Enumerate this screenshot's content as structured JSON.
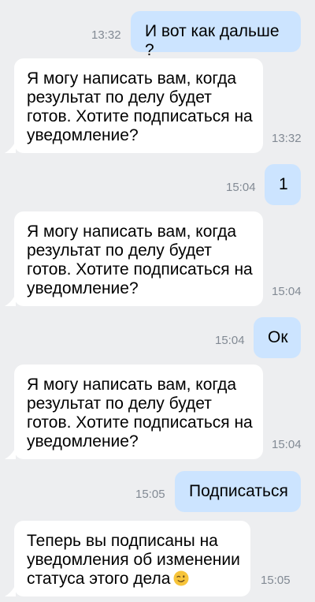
{
  "messages": [
    {
      "direction": "out",
      "text": "И вот как дальше ?",
      "time": "13:32"
    },
    {
      "direction": "in",
      "text": "Я могу написать вам, когда\nрезультат по делу будет\nготов. Хотите подписаться на\nуведомление?",
      "time": "13:32"
    },
    {
      "direction": "out",
      "text": "1",
      "time": "15:04"
    },
    {
      "direction": "in",
      "text": "Я могу написать вам, когда\nрезультат по делу будет\nготов. Хотите подписаться на\nуведомление?",
      "time": "15:04"
    },
    {
      "direction": "out",
      "text": "Ок",
      "time": "15:04"
    },
    {
      "direction": "in",
      "text": "Я могу написать вам, когда\nрезультат по делу будет\nготов. Хотите подписаться на\nуведомление?",
      "time": "15:04"
    },
    {
      "direction": "out",
      "text": "Подписаться",
      "time": "15:05"
    },
    {
      "direction": "in",
      "text": "Теперь вы подписаны на\nуведомления об изменении\nстатуса этого дела",
      "time": "15:05",
      "emoji": "winking-face"
    }
  ],
  "colors": {
    "background": "#edeef0",
    "outgoing_bubble": "#cce4ff",
    "incoming_bubble": "#ffffff",
    "timestamp": "#828a94"
  }
}
